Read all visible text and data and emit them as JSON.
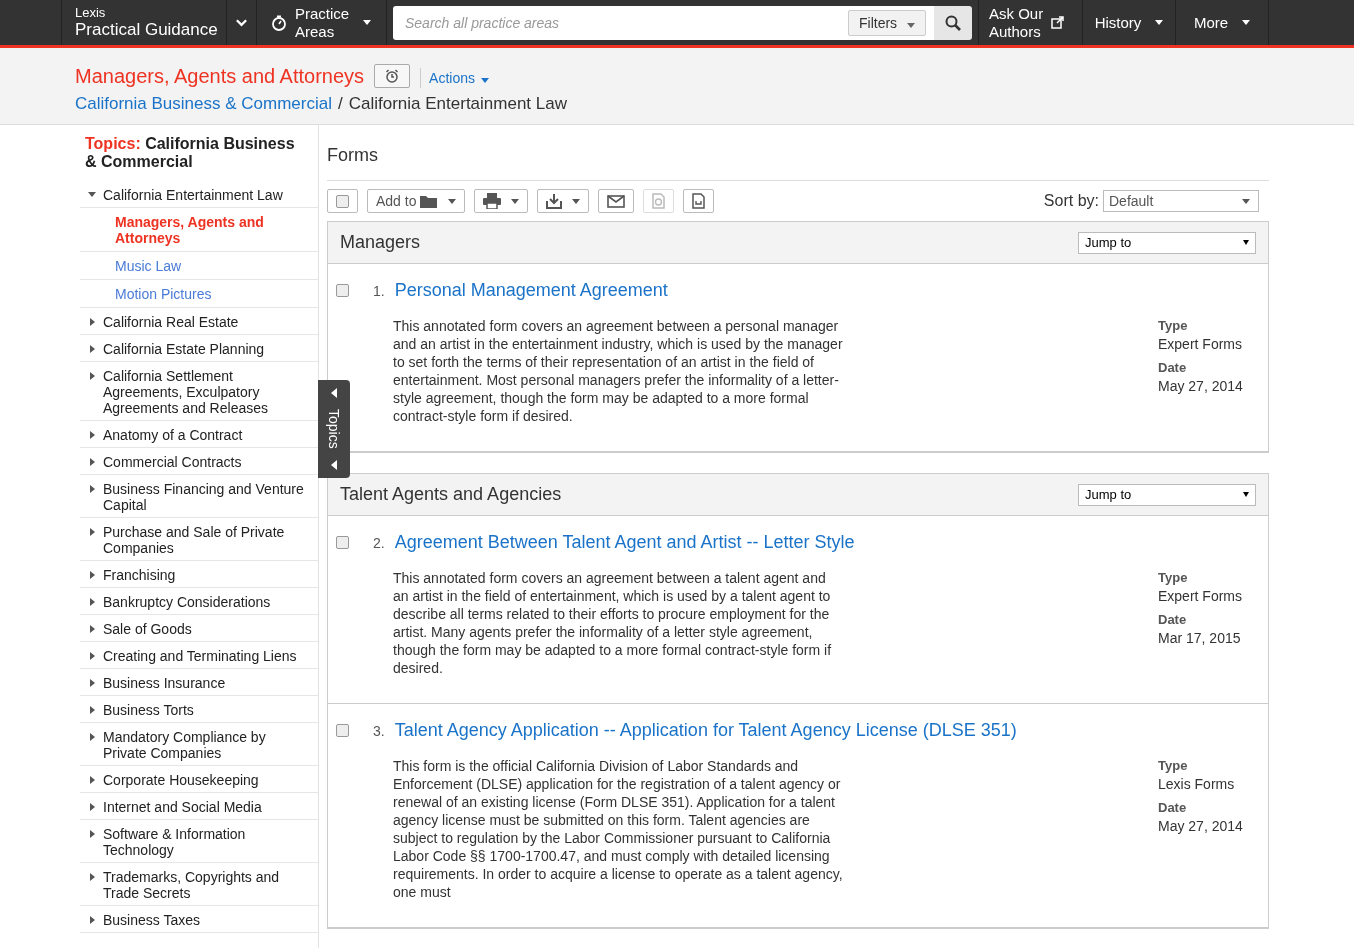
{
  "topbar": {
    "brand_top": "Lexis",
    "brand_main": "Practical Guidance",
    "practice_areas": "Practice\nAreas",
    "search": {
      "placeholder": "Search all practice areas"
    },
    "filters": "Filters",
    "ask": "Ask Our\nAuthors",
    "history": "History",
    "more": "More"
  },
  "header": {
    "title": "Managers, Agents and Attorneys",
    "actions": "Actions",
    "breadcrumb_link": "California Business & Commercial",
    "breadcrumb_separator": "/",
    "breadcrumb_current": "California Entertainment Law"
  },
  "sidebar": {
    "prefix": "Topics:",
    "title": "California Business & Commercial",
    "items": [
      {
        "label": "California Entertainment Law",
        "expanded": true,
        "selected": false,
        "children": [
          {
            "label": "Managers, Agents and Attorneys",
            "selected": true
          },
          {
            "label": "Music Law",
            "selected": false
          },
          {
            "label": "Motion Pictures",
            "selected": false
          }
        ]
      },
      {
        "label": "California Real Estate",
        "expanded": false,
        "selected": false
      },
      {
        "label": "California Estate Planning",
        "expanded": false,
        "selected": false
      },
      {
        "label": "California Settlement Agreements, Exculpatory Agreements and Releases",
        "expanded": false,
        "selected": false
      },
      {
        "label": "Anatomy of a Contract",
        "expanded": false,
        "selected": false
      },
      {
        "label": "Commercial Contracts",
        "expanded": false,
        "selected": false
      },
      {
        "label": "Business Financing and Venture Capital",
        "expanded": false,
        "selected": false
      },
      {
        "label": "Purchase and Sale of Private Companies",
        "expanded": false,
        "selected": false
      },
      {
        "label": "Franchising",
        "expanded": false,
        "selected": false
      },
      {
        "label": "Bankruptcy Considerations",
        "expanded": false,
        "selected": false
      },
      {
        "label": "Sale of Goods",
        "expanded": false,
        "selected": false
      },
      {
        "label": "Creating and Terminating Liens",
        "expanded": false,
        "selected": false
      },
      {
        "label": "Business Insurance",
        "expanded": false,
        "selected": false
      },
      {
        "label": "Business Torts",
        "expanded": false,
        "selected": false
      },
      {
        "label": "Mandatory Compliance by Private Companies",
        "expanded": false,
        "selected": false
      },
      {
        "label": "Corporate Housekeeping",
        "expanded": false,
        "selected": false
      },
      {
        "label": "Internet and Social Media",
        "expanded": false,
        "selected": false
      },
      {
        "label": "Software & Information Technology",
        "expanded": false,
        "selected": false
      },
      {
        "label": "Trademarks, Copyrights and Trade Secrets",
        "expanded": false,
        "selected": false
      },
      {
        "label": "Business Taxes",
        "expanded": false,
        "selected": false
      }
    ]
  },
  "topics_tab": "Topics",
  "main": {
    "heading": "Forms",
    "toolbar": {
      "select_all_checked": false,
      "add_to": "Add to",
      "sort_label": "Sort by:",
      "sort_value": "Default"
    },
    "sections": [
      {
        "title": "Managers",
        "jump": "Jump to",
        "items": [
          {
            "number": "1.",
            "title": "Personal Management Agreement",
            "checked": false,
            "description": "This annotated form covers an agreement between a personal manager and an artist in the entertainment industry, which is used by the manager to set forth the terms of their representation of an artist in the field of entertainment. Most personal managers prefer the informality of a letter-style agreement, though the form may be adapted to a more formal contract-style form if desired.",
            "type_label": "Type",
            "type": "Expert Forms",
            "date_label": "Date",
            "date": "May 27, 2014"
          }
        ]
      },
      {
        "title": "Talent Agents and Agencies",
        "jump": "Jump to",
        "items": [
          {
            "number": "2.",
            "title": "Agreement Between Talent Agent and Artist -- Letter Style",
            "checked": false,
            "description": "This annotated form covers an agreement between a talent agent and an artist in the field of entertainment, which is used by a talent agent to describe all terms related to their efforts to procure employment for the artist. Many agents prefer the informality of a letter style agreement, though the form may be adapted to a more formal contract-style form if desired.",
            "type_label": "Type",
            "type": "Expert Forms",
            "date_label": "Date",
            "date": "Mar 17, 2015"
          },
          {
            "number": "3.",
            "title": "Talent Agency Application -- Application for Talent Agency License (DLSE 351)",
            "checked": false,
            "description": "This form is the official California Division of Labor Standards and Enforcement (DLSE) application for the registration of a talent agency or renewal of an existing license (Form DLSE 351). Application for a talent agency license must be submitted on this form. Talent agencies are subject to regulation by the Labor Commissioner pursuant to California Labor Code §§ 1700-1700.47, and must comply with detailed licensing requirements. In order to acquire a license to operate as a talent agency, one must",
            "type_label": "Type",
            "type": "Lexis Forms",
            "date_label": "Date",
            "date": "May 27, 2014"
          }
        ]
      }
    ]
  }
}
